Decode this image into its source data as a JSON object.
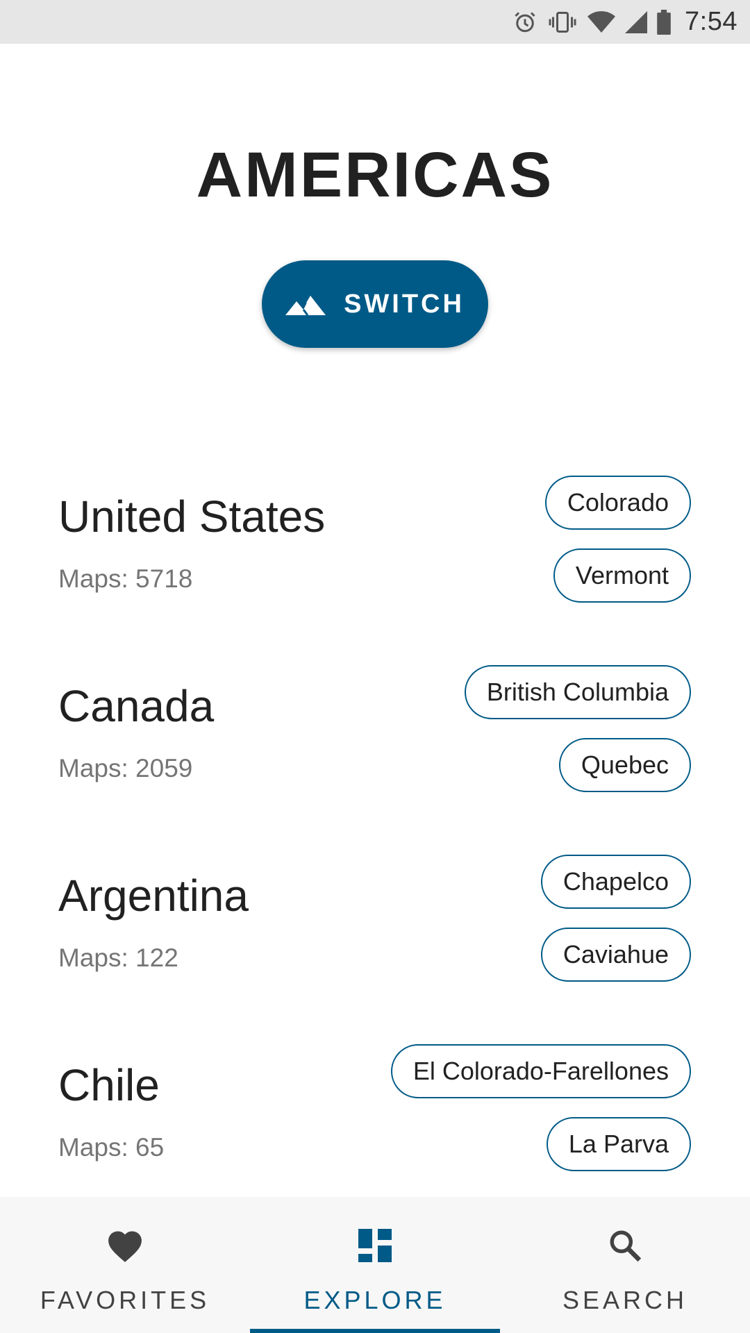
{
  "status_bar": {
    "time": "7:54",
    "icons": [
      "alarm-icon",
      "vibrate-icon",
      "wifi-icon",
      "signal-icon",
      "battery-icon"
    ]
  },
  "header": {
    "title": "AMERICAS",
    "switch_label": "SWITCH",
    "switch_icon": "mountain-icon"
  },
  "countries": [
    {
      "name": "United States",
      "maps": "Maps: 5718",
      "chips": [
        "Colorado",
        "Vermont"
      ]
    },
    {
      "name": "Canada",
      "maps": "Maps: 2059",
      "chips": [
        "British Columbia",
        "Quebec"
      ]
    },
    {
      "name": "Argentina",
      "maps": "Maps: 122",
      "chips": [
        "Chapelco",
        "Caviahue"
      ]
    },
    {
      "name": "Chile",
      "maps": "Maps: 65",
      "chips": [
        "El Colorado-Farellones",
        "La Parva"
      ]
    }
  ],
  "bottom_nav": {
    "items": [
      {
        "label": "FAVORITES",
        "icon": "heart-icon"
      },
      {
        "label": "EXPLORE",
        "icon": "dashboard-icon"
      },
      {
        "label": "SEARCH",
        "icon": "search-icon"
      }
    ],
    "active": "EXPLORE"
  },
  "colors": {
    "accent": "#005a87",
    "status_bar": "#e6e6e6",
    "nav_background": "#f7f7f7",
    "secondary_text": "#757575"
  }
}
